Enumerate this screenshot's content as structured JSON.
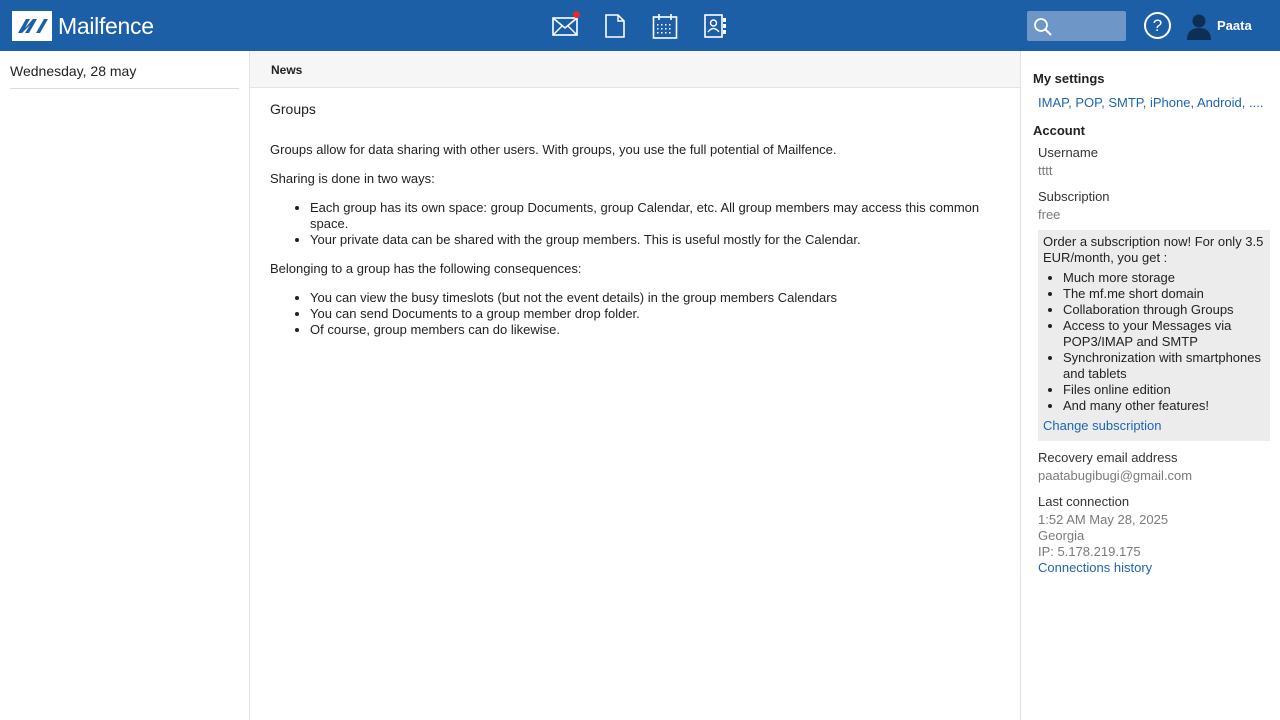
{
  "app": {
    "logo_text": "Mailfence",
    "user_name": "Paata",
    "help_glyph": "?",
    "brand_color": "#1d5fa6",
    "nav_icons": [
      "mail-icon",
      "document-icon",
      "calendar-icon",
      "contacts-icon"
    ],
    "mail_has_notification": true
  },
  "left": {
    "date": "Wednesday, 28 may"
  },
  "center": {
    "header": "News",
    "title": "Groups",
    "intro": "Groups allow for data sharing with other users. With groups, you use the full potential of Mailfence.",
    "sharing_title": "Sharing is done in two ways:",
    "sharing_items": [
      "Each group has its own space: group Documents, group Calendar, etc. All group members may access this common space.",
      "Your private data can be shared with the group members. This is useful mostly for the Calendar."
    ],
    "belonging_title": "Belonging to a group has the following consequences:",
    "belonging_items": [
      "You can view the busy timeslots (but not the event details) in the group members Calendars",
      "You can send Documents to a group member drop folder.",
      "Of course, group members can do likewise."
    ]
  },
  "right": {
    "my_settings_title": "My settings",
    "settings_link": "IMAP, POP, SMTP, iPhone, Android, ....",
    "account_title": "Account",
    "username_label": "Username",
    "username_value": "tttt",
    "subscription_label": "Subscription",
    "subscription_value": "free",
    "promo_text": "Order a subscription now! For only 3.5 EUR/month, you get :",
    "promo_items": [
      "Much more storage",
      "The mf.me short domain",
      "Collaboration through Groups",
      "Access to your Messages via POP3/IMAP and SMTP",
      "Synchronization with smartphones and tablets",
      "Files online edition",
      "And many other features!"
    ],
    "change_subscription": "Change subscription",
    "recovery_label": "Recovery email address",
    "recovery_value": "paatabugibugi@gmail.com",
    "last_connection_label": "Last connection",
    "last_connection_time": "1:52 AM May 28, 2025",
    "last_connection_country": "Georgia",
    "last_connection_ip": "IP: 5.178.219.175",
    "connections_history": "Connections history"
  }
}
